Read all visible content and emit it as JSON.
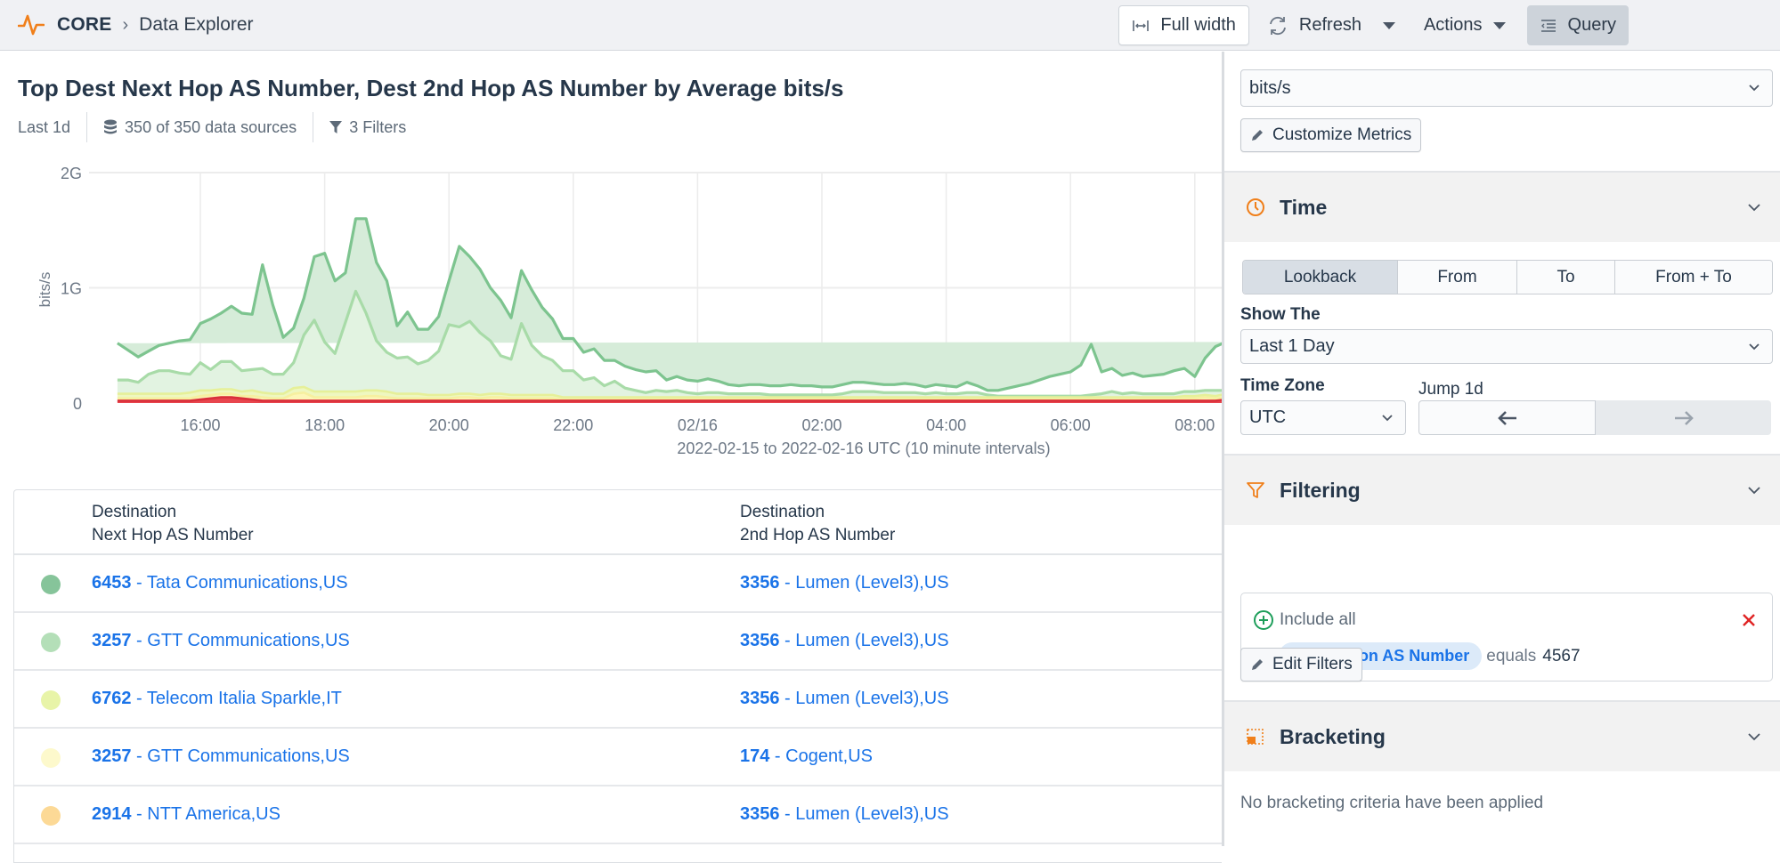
{
  "topbar": {
    "brand": "CORE",
    "breadcrumb": "Data Explorer",
    "full_width_label": "Full width",
    "refresh_label": "Refresh",
    "actions_label": "Actions",
    "query_label": "Query"
  },
  "main": {
    "title": "Top Dest Next Hop AS Number, Dest 2nd Hop AS Number by Average bits/s",
    "lookback": "Last 1d",
    "data_sources": "350 of 350 data sources",
    "filters": "3 Filters"
  },
  "chart_data": {
    "type": "area",
    "stacked": true,
    "title": "",
    "xlabel": "2022-02-15 to 2022-02-16 UTC (10 minute intervals)",
    "ylabel": "bits/s",
    "y_ticks": [
      "0",
      "1G",
      "2G"
    ],
    "ylim": [
      0,
      2000000000
    ],
    "x_ticks": [
      "16:00",
      "18:00",
      "20:00",
      "22:00",
      "02/16",
      "02:00",
      "04:00",
      "06:00",
      "08:00"
    ],
    "x_start": "2022-02-15 14:40",
    "interval_minutes": 10,
    "grid": true,
    "legend": "none",
    "series": [
      {
        "name": "2914 - NTT America,US / 3356 - Lumen (Level3),US",
        "color": "#e8464e",
        "values_g": [
          0.02,
          0.02,
          0.02,
          0.02,
          0.02,
          0.02,
          0.02,
          0.02,
          0.03,
          0.04,
          0.05,
          0.05,
          0.04,
          0.03,
          0.02,
          0.02,
          0.02,
          0.02,
          0.02,
          0.02,
          0.02,
          0.02,
          0.02,
          0.02,
          0.02,
          0.02,
          0.02,
          0.02,
          0.02,
          0.02,
          0.02,
          0.02,
          0.02,
          0.02,
          0.02,
          0.02,
          0.02,
          0.02,
          0.02,
          0.02,
          0.02,
          0.02,
          0.02,
          0.02,
          0.02,
          0.02,
          0.02,
          0.02,
          0.02,
          0.02,
          0.02,
          0.02,
          0.02,
          0.02,
          0.02,
          0.02,
          0.02,
          0.02,
          0.02,
          0.02,
          0.02,
          0.02,
          0.02,
          0.02,
          0.02,
          0.02,
          0.02,
          0.02,
          0.02,
          0.02,
          0.02,
          0.02,
          0.02,
          0.02,
          0.02,
          0.02,
          0.02,
          0.02,
          0.02,
          0.02,
          0.02,
          0.02,
          0.02,
          0.02,
          0.02,
          0.02,
          0.02,
          0.02,
          0.02,
          0.02,
          0.02,
          0.02,
          0.02,
          0.02,
          0.02,
          0.02,
          0.02,
          0.02,
          0.02,
          0.02,
          0.02,
          0.02,
          0.02,
          0.02,
          0.02,
          0.02,
          0.02,
          0.03
        ]
      },
      {
        "name": "3257 - GTT Communications,US / 174 - Cogent,US",
        "color": "#fdf9c4",
        "values_g": [
          0.02,
          0.02,
          0.02,
          0.02,
          0.02,
          0.02,
          0.02,
          0.02,
          0.03,
          0.03,
          0.03,
          0.03,
          0.02,
          0.03,
          0.03,
          0.02,
          0.02,
          0.06,
          0.07,
          0.03,
          0.03,
          0.03,
          0.03,
          0.03,
          0.04,
          0.04,
          0.03,
          0.02,
          0.02,
          0.02,
          0.02,
          0.02,
          0.02,
          0.03,
          0.03,
          0.02,
          0.03,
          0.03,
          0.02,
          0.02,
          0.02,
          0.02,
          0.02,
          0.01,
          0.01,
          0.01,
          0.01,
          0.01,
          0.01,
          0.01,
          0.01,
          0.01,
          0.01,
          0.01,
          0.01,
          0.01,
          0.01,
          0.01,
          0.01,
          0.01,
          0.01,
          0.01,
          0.01,
          0.01,
          0.01,
          0.01,
          0.01,
          0.01,
          0.01,
          0.01,
          0.01,
          0.01,
          0.01,
          0.01,
          0.01,
          0.01,
          0.01,
          0.01,
          0.01,
          0.01,
          0.01,
          0.01,
          0.01,
          0.01,
          0.01,
          0.01,
          0.01,
          0.01,
          0.01,
          0.01,
          0.01,
          0.01,
          0.01,
          0.01,
          0.01,
          0.01,
          0.01,
          0.01,
          0.01,
          0.01,
          0.01,
          0.01,
          0.01,
          0.02,
          0.02,
          0.03,
          0.02,
          0.02
        ]
      },
      {
        "name": "6762 - Telecom Italia Sparkle,IT / 3356 - Lumen (Level3),US",
        "color": "#e8f4a8",
        "values_g": [
          0.04,
          0.04,
          0.04,
          0.04,
          0.04,
          0.04,
          0.04,
          0.05,
          0.05,
          0.04,
          0.04,
          0.04,
          0.04,
          0.05,
          0.04,
          0.04,
          0.04,
          0.05,
          0.05,
          0.05,
          0.05,
          0.05,
          0.05,
          0.05,
          0.05,
          0.05,
          0.05,
          0.04,
          0.04,
          0.04,
          0.03,
          0.03,
          0.03,
          0.03,
          0.03,
          0.03,
          0.03,
          0.03,
          0.03,
          0.03,
          0.03,
          0.03,
          0.03,
          0.02,
          0.02,
          0.02,
          0.02,
          0.02,
          0.02,
          0.02,
          0.02,
          0.02,
          0.02,
          0.02,
          0.02,
          0.02,
          0.02,
          0.02,
          0.02,
          0.02,
          0.02,
          0.02,
          0.02,
          0.02,
          0.02,
          0.02,
          0.02,
          0.02,
          0.02,
          0.02,
          0.02,
          0.02,
          0.02,
          0.02,
          0.02,
          0.02,
          0.02,
          0.02,
          0.02,
          0.02,
          0.02,
          0.02,
          0.02,
          0.02,
          0.02,
          0.02,
          0.02,
          0.02,
          0.02,
          0.02,
          0.02,
          0.02,
          0.02,
          0.02,
          0.02,
          0.02,
          0.02,
          0.02,
          0.02,
          0.02,
          0.02,
          0.02,
          0.02,
          0.02,
          0.02,
          0.02,
          0.02,
          0.03
        ]
      },
      {
        "name": "3257 - GTT Communications,US / 3356 - Lumen (Level3),US",
        "color": "#a8dba8",
        "values_g": [
          0.12,
          0.12,
          0.1,
          0.17,
          0.2,
          0.2,
          0.18,
          0.16,
          0.24,
          0.18,
          0.24,
          0.24,
          0.18,
          0.18,
          0.21,
          0.17,
          0.17,
          0.22,
          0.45,
          0.62,
          0.43,
          0.33,
          0.6,
          0.87,
          0.67,
          0.43,
          0.34,
          0.31,
          0.32,
          0.26,
          0.3,
          0.38,
          0.61,
          0.58,
          0.63,
          0.54,
          0.46,
          0.33,
          0.31,
          0.62,
          0.43,
          0.34,
          0.3,
          0.23,
          0.23,
          0.15,
          0.17,
          0.1,
          0.14,
          0.08,
          0.06,
          0.04,
          0.06,
          0.05,
          0.06,
          0.04,
          0.03,
          0.04,
          0.04,
          0.03,
          0.03,
          0.03,
          0.03,
          0.02,
          0.02,
          0.02,
          0.02,
          0.02,
          0.02,
          0.02,
          0.03,
          0.05,
          0.05,
          0.05,
          0.04,
          0.04,
          0.04,
          0.04,
          0.03,
          0.04,
          0.03,
          0.03,
          0.04,
          0.04,
          0.02,
          0.01,
          0.01,
          0.01,
          0.01,
          0.01,
          0.01,
          0.01,
          0.01,
          0.01,
          0.02,
          0.03,
          0.05,
          0.03,
          0.04,
          0.03,
          0.03,
          0.03,
          0.03,
          0.04,
          0.04,
          0.04,
          0.05,
          0.03
        ]
      },
      {
        "name": "6453 - Tata Communications,US / 3356 - Lumen (Level3),US",
        "color": "#7dc48f",
        "values_g": [
          0.32,
          0.26,
          0.22,
          0.2,
          0.22,
          0.24,
          0.28,
          0.3,
          0.34,
          0.44,
          0.42,
          0.48,
          0.5,
          0.48,
          0.9,
          0.6,
          0.32,
          0.3,
          0.32,
          0.55,
          0.77,
          0.63,
          0.43,
          0.63,
          0.82,
          0.68,
          0.62,
          0.28,
          0.39,
          0.3,
          0.27,
          0.3,
          0.38,
          0.7,
          0.56,
          0.55,
          0.46,
          0.48,
          0.36,
          0.46,
          0.48,
          0.42,
          0.36,
          0.28,
          0.28,
          0.24,
          0.25,
          0.22,
          0.18,
          0.19,
          0.18,
          0.18,
          0.17,
          0.1,
          0.12,
          0.11,
          0.11,
          0.12,
          0.1,
          0.08,
          0.07,
          0.08,
          0.08,
          0.08,
          0.08,
          0.09,
          0.08,
          0.08,
          0.07,
          0.07,
          0.08,
          0.08,
          0.08,
          0.07,
          0.07,
          0.07,
          0.08,
          0.07,
          0.06,
          0.07,
          0.07,
          0.06,
          0.09,
          0.06,
          0.04,
          0.05,
          0.07,
          0.09,
          0.11,
          0.14,
          0.17,
          0.19,
          0.21,
          0.27,
          0.44,
          0.19,
          0.2,
          0.16,
          0.17,
          0.15,
          0.16,
          0.17,
          0.2,
          0.2,
          0.13,
          0.28,
          0.38,
          0.42,
          0.44,
          0.5,
          0.46,
          0.45
        ]
      }
    ]
  },
  "table": {
    "columns": [
      {
        "line1": "Destination",
        "line2": "Next Hop AS Number"
      },
      {
        "line1": "Destination",
        "line2": "2nd Hop AS Number"
      }
    ],
    "rows": [
      {
        "color": "#86c49a",
        "next_asn": "6453",
        "next_name": " - Tata Communications,US",
        "hop2_asn": "3356",
        "hop2_name": " - Lumen (Level3),US"
      },
      {
        "color": "#b4dfb8",
        "next_asn": "3257",
        "next_name": " - GTT Communications,US",
        "hop2_asn": "3356",
        "hop2_name": " - Lumen (Level3),US"
      },
      {
        "color": "#e8f4a8",
        "next_asn": "6762",
        "next_name": " - Telecom Italia Sparkle,IT",
        "hop2_asn": "3356",
        "hop2_name": " - Lumen (Level3),US"
      },
      {
        "color": "#fdf9cc",
        "next_asn": "3257",
        "next_name": " - GTT Communications,US",
        "hop2_asn": "174",
        "hop2_name": " - Cogent,US"
      },
      {
        "color": "#fcd996",
        "next_asn": "2914",
        "next_name": " - NTT America,US",
        "hop2_asn": "3356",
        "hop2_name": " - Lumen (Level3),US"
      }
    ]
  },
  "sidebar": {
    "metric_select": "bits/s",
    "customize_metrics_label": "Customize Metrics",
    "time": {
      "title": "Time",
      "modes": [
        "Lookback",
        "From",
        "To",
        "From + To"
      ],
      "active_mode": "Lookback",
      "show_the_label": "Show The",
      "show_the_value": "Last 1 Day",
      "time_zone_label": "Time Zone",
      "time_zone_value": "UTC",
      "jump_label": "Jump 1d"
    },
    "filtering": {
      "title": "Filtering",
      "include_label": "Include all",
      "filter_field": "Destination AS Number",
      "filter_op": "equals",
      "filter_value": "4567",
      "edit_filters_label": "Edit Filters"
    },
    "bracketing": {
      "title": "Bracketing",
      "empty_text": "No bracketing criteria have been applied"
    }
  },
  "colors": {
    "accent_orange": "#f07f1a",
    "link_blue": "#1a73e8",
    "remove_red": "#e02424",
    "include_green": "#1d9e5a"
  }
}
